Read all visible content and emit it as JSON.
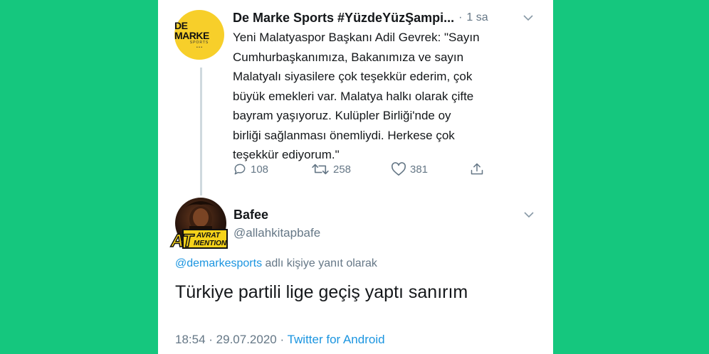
{
  "tweet1": {
    "avatar": {
      "logo_main": "DE MARKE",
      "logo_sub": "SPORTS",
      "logo_dots": "• • •"
    },
    "display_name": "De Marke Sports #YüzdeYüzŞampi...",
    "separator": "·",
    "time": "1 sa",
    "text": "Yeni Malatyaspor Başkanı Adil Gevrek: \"Sayın\nCumhurbaşkanımıza, Bakanımıza ve sayın\nMalatyalı siyasilere çok teşekkür ederim, çok\nbüyük emekleri var. Malatya halkı olarak çifte\nbayram yaşıyoruz. Kulüpler Birliği'nde oy\nbirliği sağlanması önemliydi. Herkese çok\nteşekkür ediyorum.\"",
    "actions": {
      "replies": "108",
      "retweets": "258",
      "likes": "381"
    }
  },
  "tweet2": {
    "avatar_badge": {
      "big": "AT",
      "line1": "AVRAT",
      "line2": "MENTION"
    },
    "display_name": "Bafee",
    "handle": "@allahkitapbafe",
    "reply_mention": "@demarkesports",
    "reply_suffix": " adlı kişiye yanıt olarak",
    "text": "Türkiye partili lige geçiş yaptı sanırım",
    "time": "18:54",
    "sep1": " · ",
    "date": "29.07.2020",
    "sep2": " · ",
    "source": "Twitter for Android"
  },
  "icons": [
    "reply-icon",
    "retweet-icon",
    "like-icon",
    "share-icon",
    "chevron-down-icon"
  ],
  "colors": {
    "background": "#15c77e",
    "card": "#ffffff",
    "text": "#14171a",
    "muted": "#657786",
    "link": "#1b95e0",
    "logo_yellow": "#f7cf2a"
  }
}
